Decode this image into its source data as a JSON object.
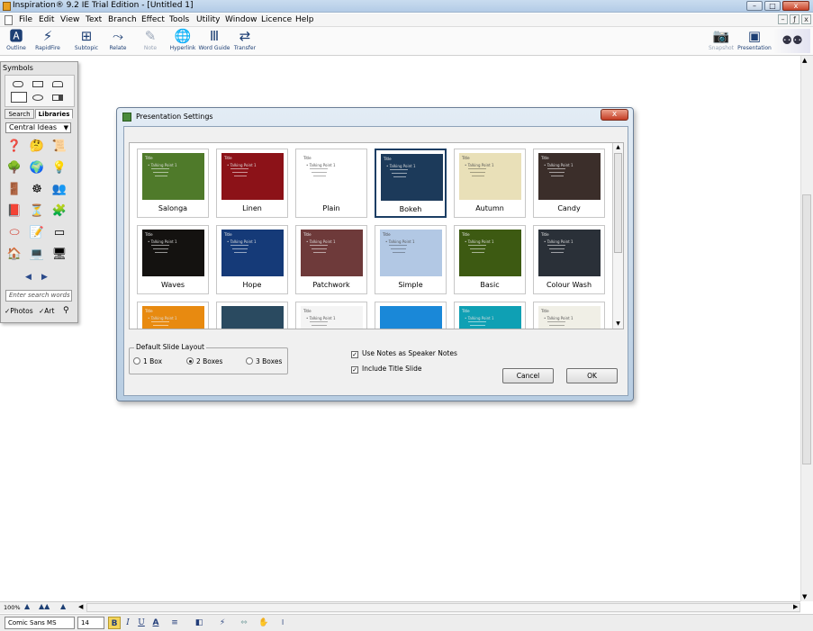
{
  "window": {
    "title": "Inspiration® 9.2 IE Trial Edition - [Untitled 1]",
    "min": "–",
    "max": "□",
    "close": "x"
  },
  "menu": [
    "File",
    "Edit",
    "View",
    "Text",
    "Branch",
    "Effect",
    "Tools",
    "Utility",
    "Window",
    "Licence",
    "Help"
  ],
  "mdi": {
    "min": "–",
    "restore": "ƒ",
    "close": "x"
  },
  "toolbar": {
    "outline": "Outline",
    "rapidfire": "RapidFire",
    "subtopic": "Subtopic",
    "relate": "Relate",
    "note": "Note",
    "hyperlink": "Hyperlink",
    "word_guide": "Word Guide",
    "transfer": "Transfer",
    "snapshot": "Snapshot",
    "presentation": "Presentation"
  },
  "symbols": {
    "title": "Symbols",
    "tab_search": "Search",
    "tab_libraries": "Libraries",
    "library": "Central Ideas",
    "search_placeholder": "Enter search words",
    "photos": "Photos",
    "art": "Art"
  },
  "dialog": {
    "title": "Presentation Settings",
    "close": "x",
    "themes": [
      {
        "name": "Salonga",
        "bg": "#4f7a2a",
        "title": "Title",
        "selected": false
      },
      {
        "name": "Linen",
        "bg": "#8c1218",
        "title": "Title",
        "selected": false
      },
      {
        "name": "Plain",
        "bg": "#ffffff",
        "title": "Title",
        "selected": false
      },
      {
        "name": "Bokeh",
        "bg": "#1c3a5a",
        "title": "Title",
        "selected": true
      },
      {
        "name": "Autumn",
        "bg": "#e9e0b8",
        "title": "Title",
        "selected": false
      },
      {
        "name": "Candy",
        "bg": "#3b2e2a",
        "title": "Title",
        "selected": false
      },
      {
        "name": "Waves",
        "bg": "#141210",
        "title": "Title",
        "selected": false
      },
      {
        "name": "Hope",
        "bg": "#153a78",
        "title": "Title",
        "selected": false
      },
      {
        "name": "Patchwork",
        "bg": "#6e3a3a",
        "title": "Title",
        "selected": false
      },
      {
        "name": "Simple",
        "bg": "#b2c8e4",
        "title": "Title",
        "selected": false
      },
      {
        "name": "Basic",
        "bg": "#3d5a12",
        "title": "Title",
        "selected": false
      },
      {
        "name": "Colour Wash",
        "bg": "#2a3038",
        "title": "Title",
        "selected": false
      },
      {
        "name": "",
        "bg": "#e88a10",
        "title": "Title",
        "selected": false
      },
      {
        "name": "",
        "bg": "#2a4a60",
        "title": "",
        "selected": false
      },
      {
        "name": "",
        "bg": "#f4f4f4",
        "title": "Title",
        "selected": false
      },
      {
        "name": "",
        "bg": "#1a88d8",
        "title": "",
        "selected": false
      },
      {
        "name": "",
        "bg": "#0fa0b4",
        "title": "Title",
        "selected": false
      },
      {
        "name": "",
        "bg": "#f0efe6",
        "title": "Title",
        "selected": false
      }
    ],
    "bullet_sample": "• Talking Point 1",
    "default_layout": "Default Slide Layout",
    "layouts": [
      {
        "label": "1 Box",
        "checked": false
      },
      {
        "label": "2 Boxes",
        "checked": true
      },
      {
        "label": "3 Boxes",
        "checked": false
      }
    ],
    "use_notes": {
      "label": "Use Notes as Speaker Notes",
      "checked": true
    },
    "include_title": {
      "label": "Include Title Slide",
      "checked": true
    },
    "cancel": "Cancel",
    "ok": "OK"
  },
  "zoom": "100%",
  "format": {
    "font": "Comic Sans MS",
    "size": "14",
    "bold": "B",
    "italic": "I",
    "underline": "U",
    "color": "A"
  }
}
